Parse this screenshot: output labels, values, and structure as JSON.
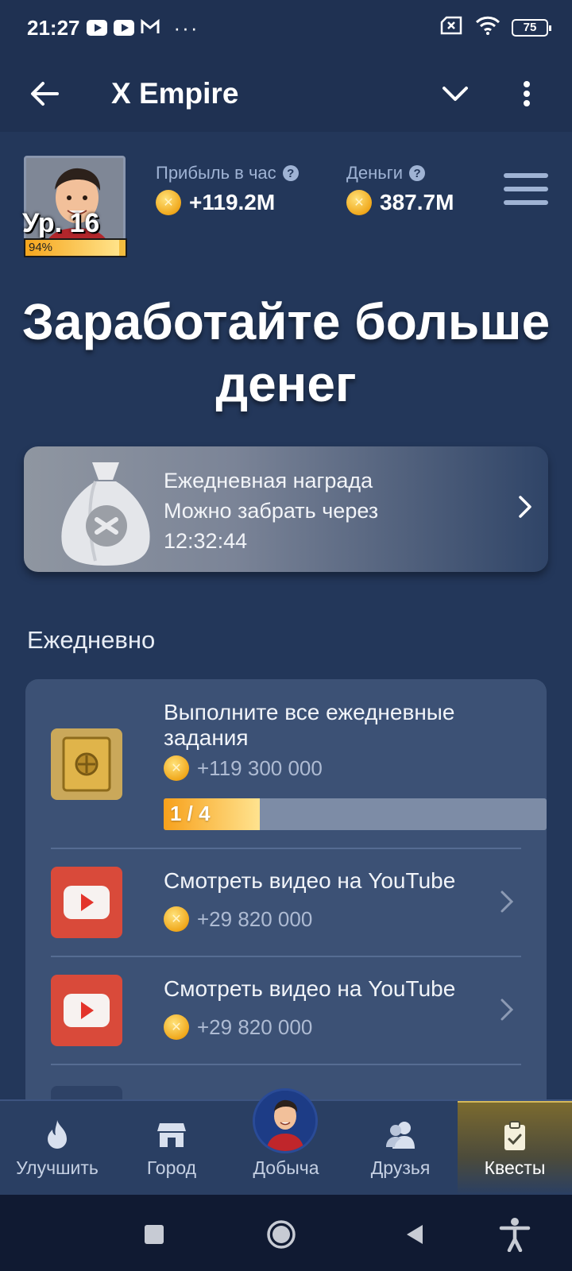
{
  "status_bar": {
    "time": "21:27",
    "battery": "75",
    "more": "···"
  },
  "app_bar": {
    "title": "X Empire"
  },
  "profile": {
    "level": "Ур. 16",
    "level_progress": 0.94,
    "level_progress_label": "94%"
  },
  "stats": {
    "profit": {
      "label": "Прибыль в час",
      "value": "+119.2M",
      "help": "?"
    },
    "money": {
      "label": "Деньги",
      "value": "387.7M",
      "help": "?"
    }
  },
  "headline": {
    "line1": "Заработайте больше",
    "line2": "денег"
  },
  "daily_reward": {
    "title": "Ежедневная награда",
    "subtitle": "Можно забрать через",
    "timer": "12:32:44"
  },
  "section": {
    "title": "Ежедневно"
  },
  "quests": [
    {
      "title_line1": "Выполните все ежедневные",
      "title_line2": "задания",
      "reward": "+119 300 000",
      "progress_label": "1 / 4",
      "progress": 0.25,
      "icon": "safe-icon"
    },
    {
      "title": "Смотреть видео на YouTube",
      "reward": "+29 820 000",
      "icon": "youtube-icon"
    },
    {
      "title": "Смотреть видео на YouTube",
      "reward": "+29 820 000",
      "icon": "youtube-icon"
    }
  ],
  "bottom_nav": [
    {
      "label": "Улучшить",
      "icon": "fire-icon"
    },
    {
      "label": "Город",
      "icon": "shop-icon"
    },
    {
      "label": "Добыча",
      "icon": "avatar-icon"
    },
    {
      "label": "Друзья",
      "icon": "friends-icon"
    },
    {
      "label": "Квесты",
      "icon": "clipboard-icon",
      "active": true
    }
  ],
  "colors": {
    "background": "#23375a",
    "accent": "#f7a11c",
    "panel": "#3c5175",
    "nav": "#2a3f63"
  }
}
